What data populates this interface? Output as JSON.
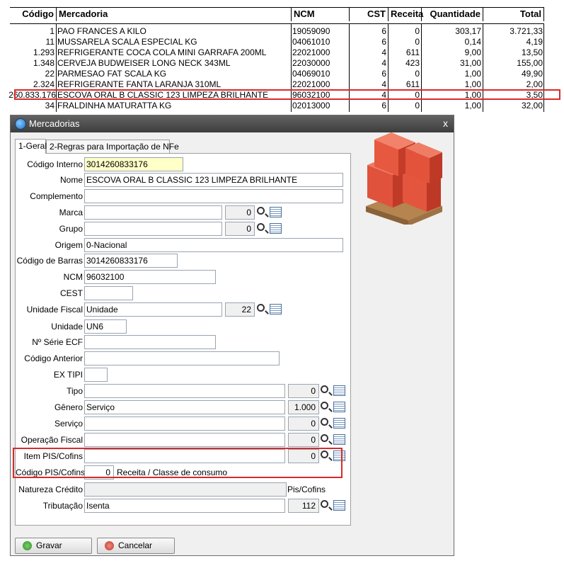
{
  "grid": {
    "headers": [
      "Código",
      "Mercadoria",
      "NCM",
      "CST",
      "Receita",
      "Quantidade",
      "Total"
    ],
    "rows": [
      [
        "1",
        "PAO FRANCES A KILO",
        "19059090",
        "6",
        "0",
        "303,17",
        "3.721,33"
      ],
      [
        "11",
        "MUSSARELA SCALA ESPECIAL KG",
        "04061010",
        "6",
        "0",
        "0,14",
        "4,19"
      ],
      [
        "1.293",
        "REFRIGERANTE COCA COLA MINI GARRAFA 200ML",
        "22021000",
        "4",
        "611",
        "9,00",
        "13,50"
      ],
      [
        "1.348",
        "CERVEJA BUDWEISER LONG NECK 343ML",
        "22030000",
        "4",
        "423",
        "31,00",
        "155,00"
      ],
      [
        "22",
        "PARMESAO FAT SCALA KG",
        "04069010",
        "6",
        "0",
        "1,00",
        "49,90"
      ],
      [
        "2.324",
        "REFRIGERANTE FANTA LARANJA 310ML",
        "22021000",
        "4",
        "611",
        "1,00",
        "2,00"
      ],
      [
        "260.833.176",
        "ESCOVA ORAL B CLASSIC 123 LIMPEZA BRILHANTE",
        "96032100",
        "4",
        "0",
        "1,00",
        "3,50"
      ],
      [
        "34",
        "FRALDINHA MATURATTA KG",
        "02013000",
        "6",
        "0",
        "1,00",
        "32,00"
      ]
    ],
    "highlighted_row_index": 6,
    "highlight_color": "#d62b2b"
  },
  "dialog": {
    "title": "Mercadorias",
    "close_glyph": "x",
    "tabs": [
      {
        "label": "1-Geral",
        "active": true
      },
      {
        "label": "2-Regras para Importação de NFe",
        "active": false
      }
    ],
    "fields": {
      "codigo_interno": {
        "label": "Código Interno",
        "value": "3014260833176"
      },
      "nome": {
        "label": "Nome",
        "value": "ESCOVA ORAL B CLASSIC 123 LIMPEZA BRILHANTE"
      },
      "complemento": {
        "label": "Complemento",
        "value": ""
      },
      "marca": {
        "label": "Marca",
        "value": "",
        "code": "0"
      },
      "grupo": {
        "label": "Grupo",
        "value": "",
        "code": "0"
      },
      "origem": {
        "label": "Origem",
        "value": "0-Nacional"
      },
      "codigo_barras": {
        "label": "Código de Barras",
        "value": "3014260833176"
      },
      "ncm": {
        "label": "NCM",
        "value": "96032100"
      },
      "cest": {
        "label": "CEST",
        "value": ""
      },
      "unidade_fiscal": {
        "label": "Unidade Fiscal",
        "value": "Unidade",
        "code": "22"
      },
      "unidade": {
        "label": "Unidade",
        "value": "UN6"
      },
      "serie_ecf": {
        "label": "Nº Série ECF",
        "value": ""
      },
      "codigo_anterior": {
        "label": "Código Anterior",
        "value": ""
      },
      "ex_tipi": {
        "label": "EX TIPI",
        "value": ""
      },
      "tipo": {
        "label": "Tipo",
        "value": "",
        "code": "0"
      },
      "genero": {
        "label": "Gênero",
        "value": "Serviço",
        "code": "1.000"
      },
      "servico": {
        "label": "Serviço",
        "value": "",
        "code": "0"
      },
      "operacao_fiscal": {
        "label": "Operação Fiscal",
        "value": "",
        "code": "0"
      },
      "item_pis_cofins": {
        "label": "Item PIS/Cofins",
        "value": "",
        "code": "0"
      },
      "codigo_pis_cofins": {
        "label": "Código PIS/Cofins",
        "value": "0",
        "suffix": "Receita / Classe de consumo"
      },
      "natureza_credito": {
        "label": "Natureza Crédito",
        "value": "",
        "ellipsis": "...",
        "suffix": "Pis/Cofins"
      },
      "tributacao": {
        "label": "Tributação",
        "value": "Isenta",
        "code": "112"
      }
    },
    "buttons": {
      "save_label": "Gravar",
      "cancel_label": "Cancelar"
    },
    "colors": {
      "selection": "#3399ff",
      "highlight": "#d62b2b"
    }
  }
}
